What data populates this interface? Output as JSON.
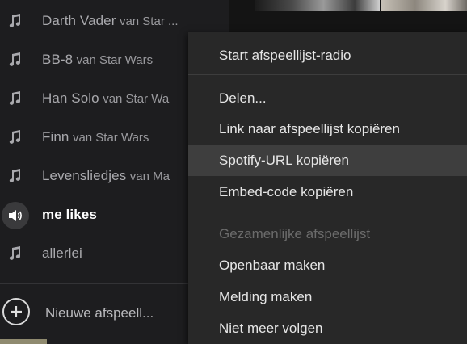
{
  "sidebar": {
    "playlists": [
      {
        "name": "Darth Vader",
        "by": "van Star ...",
        "icon": "music-note-icon",
        "active": false
      },
      {
        "name": "BB-8",
        "by": "van Star Wars",
        "icon": "music-note-icon",
        "active": false
      },
      {
        "name": "Han Solo",
        "by": "van Star Wa",
        "icon": "music-note-icon",
        "active": false
      },
      {
        "name": "Finn",
        "by": "van Star Wars",
        "icon": "music-note-icon",
        "active": false
      },
      {
        "name": "Levensliedjes",
        "by": "van Ma",
        "icon": "music-note-icon",
        "active": false
      },
      {
        "name": "me likes",
        "by": "",
        "icon": "speaker-icon",
        "active": true
      },
      {
        "name": "allerlei",
        "by": "",
        "icon": "music-note-icon",
        "active": false
      }
    ],
    "new_playlist_label": "Nieuwe afspeell..."
  },
  "context_menu": {
    "items": [
      {
        "label": "Start afspeellijst-radio",
        "enabled": true
      },
      {
        "label": "Delen...",
        "enabled": true
      },
      {
        "label": "Link naar afspeellijst kopiëren",
        "enabled": true
      },
      {
        "label": "Spotify-URL kopiëren",
        "enabled": true,
        "highlighted": true
      },
      {
        "label": "Embed-code kopiëren",
        "enabled": true
      },
      {
        "label": "Gezamenlijke afspeellijst",
        "enabled": false
      },
      {
        "label": "Openbaar maken",
        "enabled": true
      },
      {
        "label": "Melding maken",
        "enabled": true
      },
      {
        "label": "Niet meer volgen",
        "enabled": true
      }
    ]
  },
  "colors": {
    "background": "#1d1d1f",
    "menu_background": "#282828",
    "menu_highlight": "#3e3e3e",
    "active_text": "#ffffff",
    "disabled_text": "#6b6b6b"
  }
}
